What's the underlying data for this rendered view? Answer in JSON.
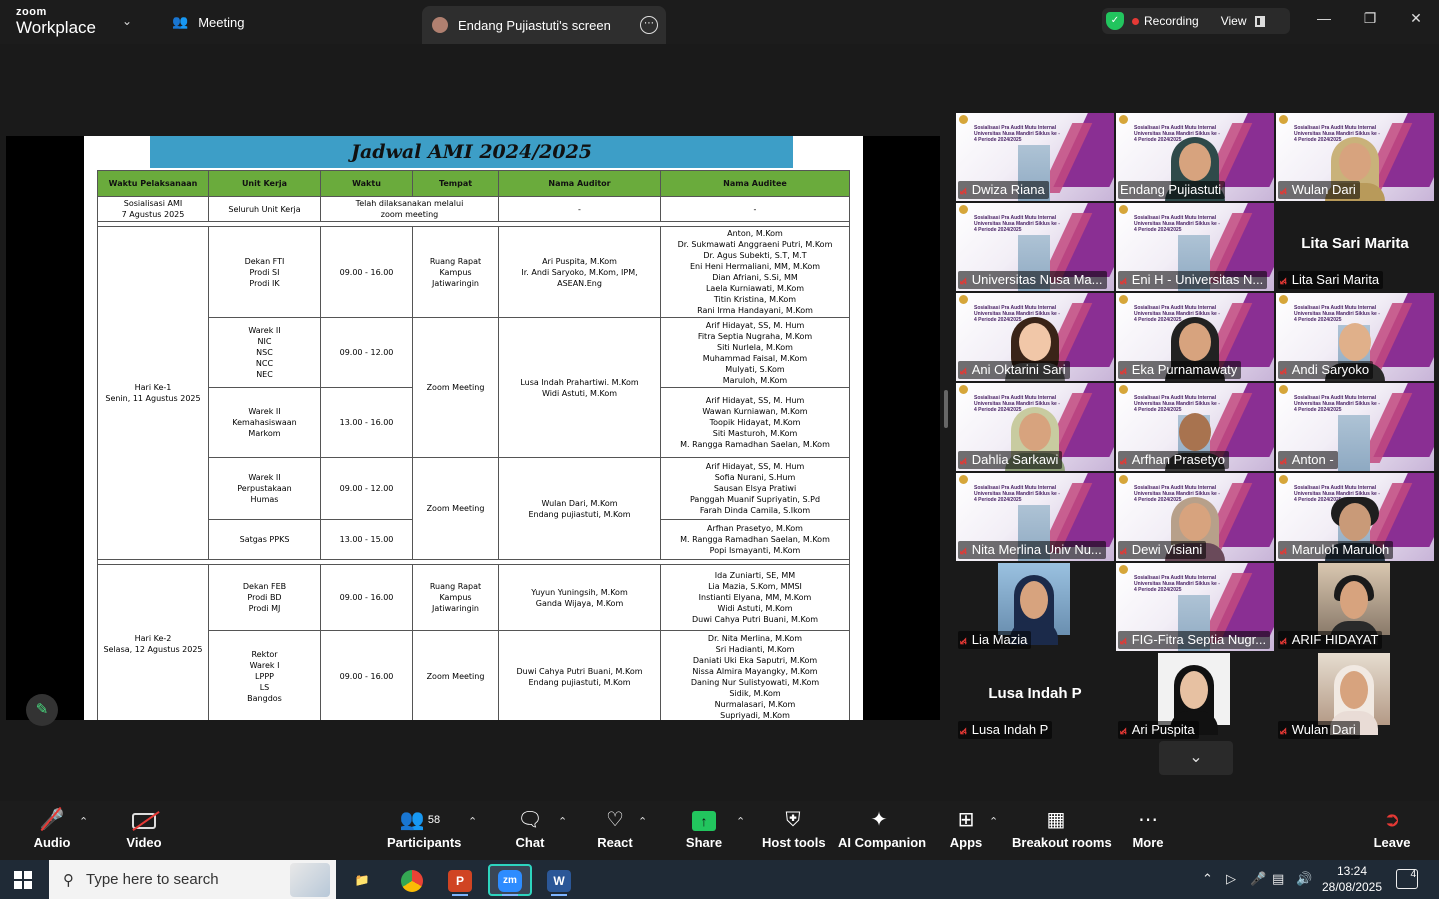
{
  "titlebar": {
    "brand_top": "zoom",
    "brand_bottom": "Workplace",
    "meeting_tab": "Meeting",
    "share_tab": "Endang Pujiastuti's screen",
    "recording": "Recording",
    "view": "View"
  },
  "document": {
    "title": "Jadwal AMI 2024/2025",
    "headers": [
      "Waktu Pelaksanaan",
      "Unit Kerja",
      "Waktu",
      "Tempat",
      "Nama Auditor",
      "Nama Auditee"
    ],
    "row0": {
      "waktu_pelaksanaan": "Sosialisasi AMI\n7 Agustus 2025",
      "unit": "Seluruh Unit Kerja",
      "info": "Telah dilaksanakan melalui\nzoom meeting",
      "auditor": "-",
      "auditee": "-"
    },
    "day1": {
      "label": "Hari Ke-1\nSenin, 11 Agustus 2025",
      "r1": {
        "unit": "Dekan FTI\nProdi SI\nProdi IK",
        "waktu": "09.00 - 16.00",
        "tempat": "Ruang Rapat\nKampus\nJatiwaringin",
        "auditor": "Ari Puspita, M.Kom\nIr. Andi Saryoko, M.Kom, IPM,\nASEAN.Eng",
        "auditee": "Anton, M.Kom\nDr. Sukmawati Anggraeni Putri, M.Kom\nDr. Agus Subekti, S.T, M.T\nEni Heni Hermaliani, MM, M.Kom\nDian Afriani, S.Si, MM\nLaela Kurniawati, M.Kom\nTitin Kristina, M.Kom\nRani Irma Handayani, M.Kom"
      },
      "r2": {
        "unit": "Warek II\nNIC\nNSC\nNCC\nNEC",
        "waktu": "09.00 - 12.00",
        "tempat": "Zoom Meeting",
        "auditor": "Lusa Indah Prahartiwi. M.Kom\nWidi Astuti, M.Kom",
        "auditee": "Arif Hidayat, SS, M. Hum\nFitra Septia Nugraha, M.Kom\nSiti Nurlela, M.Kom\nMuhammad Faisal, M.Kom\nMulyati, S.Kom\nMaruloh, M.Kom"
      },
      "r3": {
        "unit": "Warek II\nKemahasiswaan\nMarkom",
        "waktu": "13.00 - 16.00",
        "auditee": "Arif Hidayat, SS, M. Hum\nWawan Kurniawan, M.Kom\nToopik Hidayat, M.Kom\nSiti Masturoh, M.Kom\nM. Rangga Ramadhan Saelan, M.Kom"
      },
      "r4": {
        "unit": "Warek II\nPerpustakaan\nHumas",
        "waktu": "09.00 - 12.00",
        "tempat": "Zoom Meeting",
        "auditor": "Wulan Dari, M.Kom\nEndang pujiastuti, M.Kom",
        "auditee": "Arif Hidayat, SS, M. Hum\nSofia Nurani, S.Hum\nSausan Elsya Pratiwi\nPanggah Muanif Supriyatin, S.Pd\nFarah Dinda Camila, S.Ikom"
      },
      "r5": {
        "unit": "Satgas PPKS",
        "waktu": "13.00 - 15.00",
        "auditee": "Arfhan Prasetyo, M.Kom\nM. Rangga Ramadhan Saelan, M.Kom\nPopi Ismayanti, M.Kom"
      }
    },
    "day2": {
      "label": "Hari Ke-2\nSelasa, 12 Agustus 2025",
      "r1": {
        "unit": "Dekan FEB\nProdi BD\nProdi MJ",
        "waktu": "09.00 - 16.00",
        "tempat": "Ruang Rapat\nKampus\nJatiwaringin",
        "auditor": "Yuyun Yuningsih, M.Kom\nGanda Wijaya, M.Kom",
        "auditee": "Ida Zuniarti, SE, MM\nLia Mazia, S.Kom, MMSI\nInstianti Elyana, MM, M.Kom\nWidi Astuti, M.Kom\nDuwi Cahya Putri Buani, M.Kom"
      },
      "r2": {
        "unit": "Rektor\nWarek I\nLPPP\nLS\nBangdos",
        "waktu": "09.00 - 16.00",
        "tempat": "Zoom Meeting",
        "auditor": "Duwi Cahya Putri Buani, M.Kom\nEndang pujiastuti, M.Kom",
        "auditee": "Dr. Nita Merlina, M.Kom\nSri Hadianti, M.Kom\nDaniati Uki Eka Saputri, M.Kom\nNissa Almira Mayangky, M.Kom\nDaning Nur Sulistyowati, M.Kom\nSidik, M.Kom\nNurmalasari, M.Kom\nSupriyadi, M.Kom"
      }
    }
  },
  "slide_caption": "Sosialisasi Pra Audit Mutu Internal Universitas Nusa Mandiri Siklus ke - 4 Periode 2024/2025",
  "participants": [
    "Dwiza Riana",
    "Endang Pujiastuti",
    "Wulan Dari",
    "Universitas Nusa Ma...",
    "Eni H - Universitas N...",
    "Lita Sari Marita",
    "Ani Oktarini Sari",
    "Eka Purnamawaty",
    "Andi Saryoko",
    "Dahlia Sarkawi",
    "Arfhan Prasetyo",
    "Anton -",
    "Nita Merlina Univ Nu...",
    "Dewi Visiani",
    "Maruloh Maruloh",
    "Lia Mazia",
    "FIG-Fitra Septia Nugr...",
    "ARIF HIDAYAT",
    "Lusa Indah P",
    "Ari Puspita",
    "Wulan Dari"
  ],
  "big_names": {
    "lita": "Lita Sari Marita",
    "lusa": "Lusa Indah P"
  },
  "toolbar": {
    "audio": "Audio",
    "video": "Video",
    "participants": "Participants",
    "participant_count": "58",
    "chat": "Chat",
    "react": "React",
    "share": "Share",
    "host_tools": "Host tools",
    "ai_companion": "AI Companion",
    "apps": "Apps",
    "breakout": "Breakout rooms",
    "more": "More",
    "leave": "Leave"
  },
  "taskbar": {
    "search_placeholder": "Type here to search",
    "time": "13:24",
    "date": "28/08/2025",
    "notifications": "4"
  },
  "colors": {
    "accent_green": "#22c55e",
    "recording_red": "#e53935",
    "table_header": "#6aab3c",
    "title_band": "#3d9ec7",
    "active_speaker": "#2dd4bf"
  }
}
